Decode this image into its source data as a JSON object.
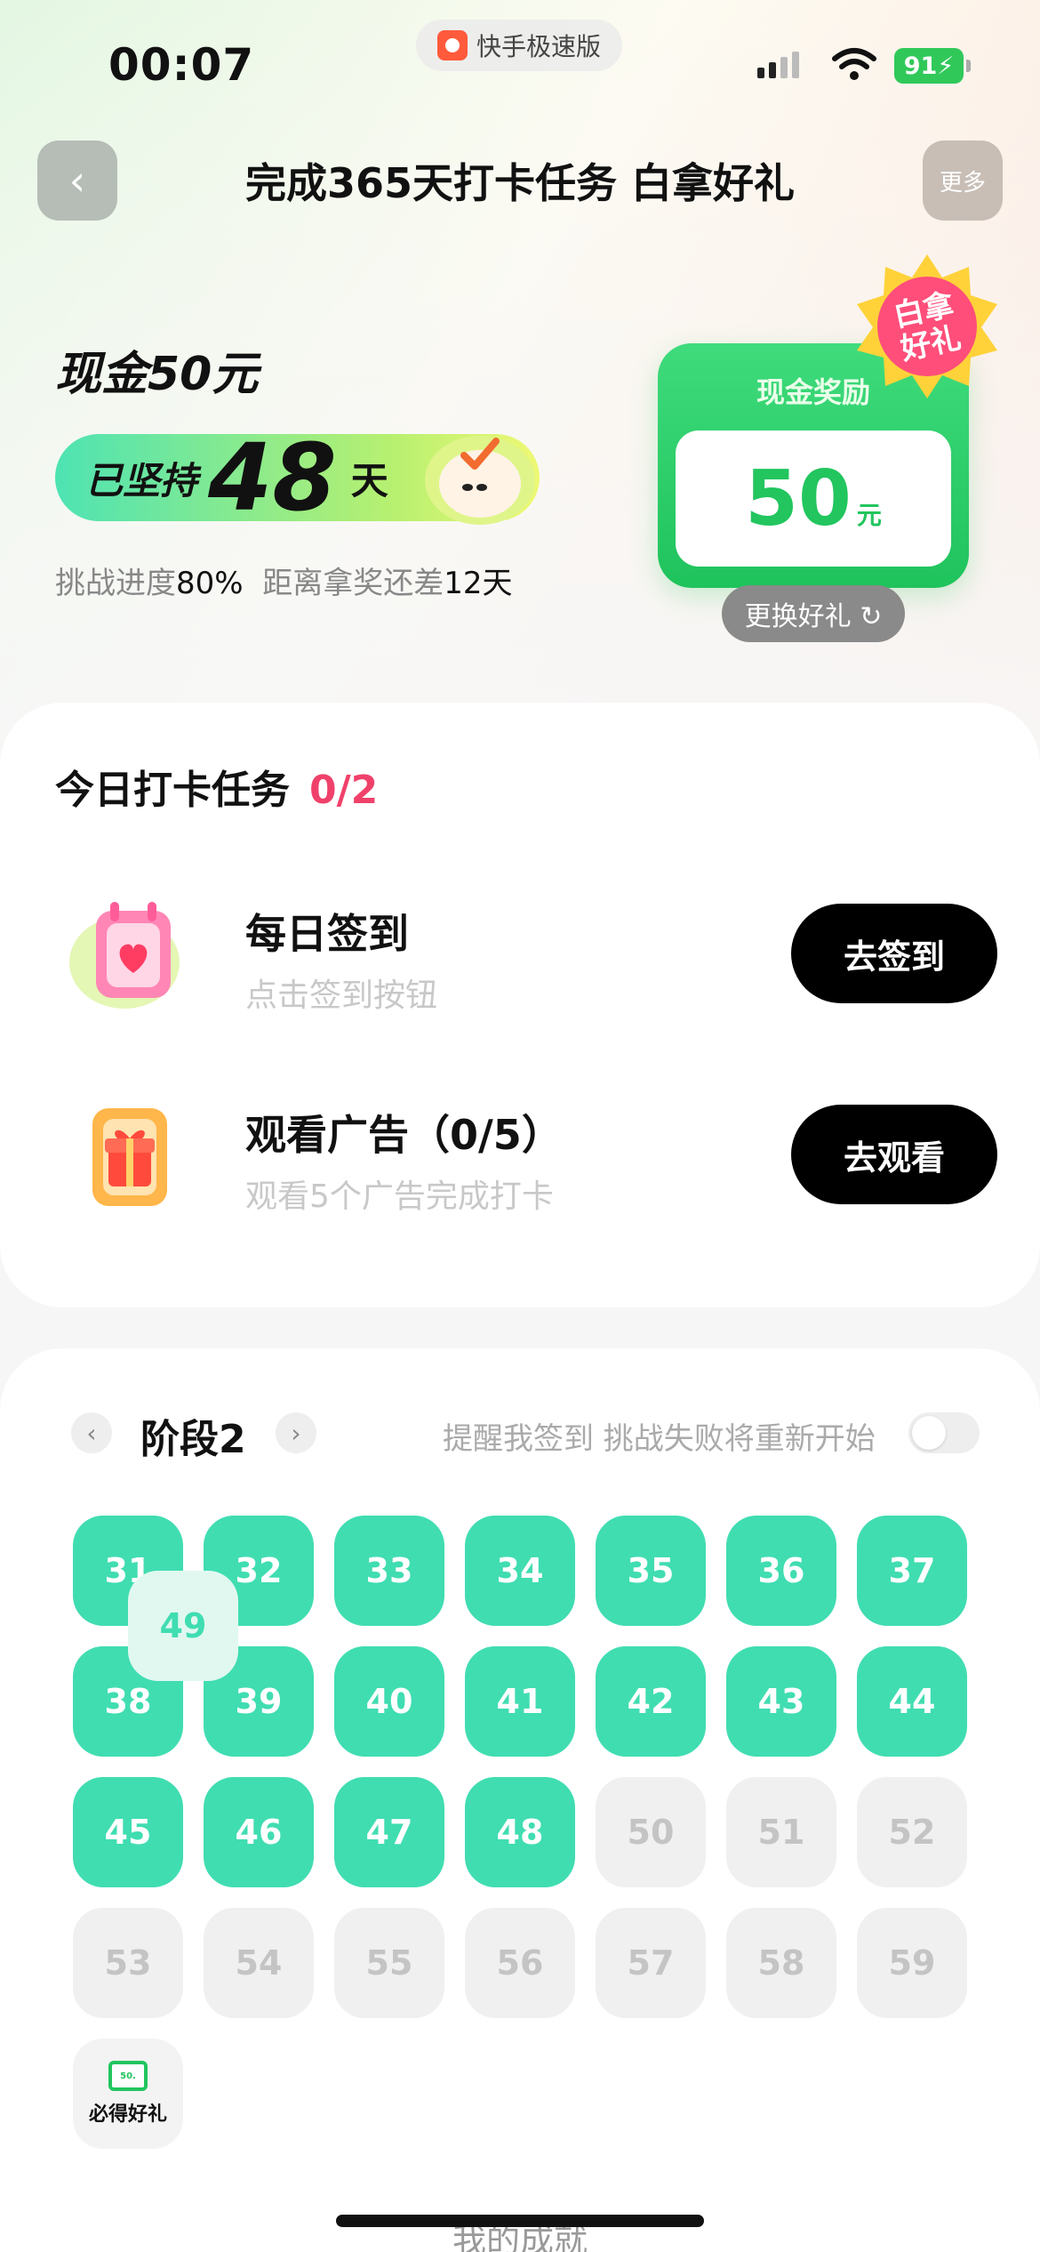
{
  "status_bar": {
    "time": "00:07",
    "app_name": "快手极速版",
    "battery": "91"
  },
  "nav": {
    "back_glyph": "‹",
    "title": "完成365天打卡任务 白拿好礼",
    "more": "更多"
  },
  "challenge": {
    "cash_title": "现金50元",
    "streak_prefix": "已坚持",
    "streak_days": "48",
    "streak_suffix": "天",
    "progress_label": "挑战进度",
    "progress_value": "80%",
    "remain_label": "距离拿奖还差",
    "remain_days": "12天"
  },
  "reward": {
    "label": "现金奖励",
    "amount": "50",
    "unit": "元",
    "badge": "白拿\n好礼",
    "swap": "更换好礼 ↻"
  },
  "today_tasks": {
    "title": "今日打卡任务",
    "count": "0/2",
    "items": [
      {
        "title": "每日签到",
        "subtitle": "点击签到按钮",
        "button": "去签到",
        "icon": "calendar-heart-icon"
      },
      {
        "title": "观看广告（0/5）",
        "subtitle": "观看5个广告完成打卡",
        "button": "去观看",
        "icon": "gift-box-icon"
      }
    ]
  },
  "stage": {
    "prev": "‹",
    "next": "›",
    "title": "阶段2",
    "remind": "提醒我签到 挑战失败将重新开始",
    "days": [
      {
        "n": "31",
        "s": "done"
      },
      {
        "n": "32",
        "s": "done"
      },
      {
        "n": "33",
        "s": "done"
      },
      {
        "n": "34",
        "s": "done"
      },
      {
        "n": "35",
        "s": "done"
      },
      {
        "n": "36",
        "s": "done"
      },
      {
        "n": "37",
        "s": "done"
      },
      {
        "n": "38",
        "s": "done"
      },
      {
        "n": "39",
        "s": "done"
      },
      {
        "n": "40",
        "s": "done"
      },
      {
        "n": "41",
        "s": "done"
      },
      {
        "n": "42",
        "s": "done"
      },
      {
        "n": "43",
        "s": "done"
      },
      {
        "n": "44",
        "s": "done"
      },
      {
        "n": "45",
        "s": "done"
      },
      {
        "n": "46",
        "s": "done"
      },
      {
        "n": "47",
        "s": "done"
      },
      {
        "n": "48",
        "s": "done"
      },
      {
        "n": "49",
        "s": "today"
      },
      {
        "n": "50",
        "s": "todo"
      },
      {
        "n": "51",
        "s": "todo"
      },
      {
        "n": "52",
        "s": "todo"
      },
      {
        "n": "53",
        "s": "todo"
      },
      {
        "n": "54",
        "s": "todo"
      },
      {
        "n": "55",
        "s": "todo"
      },
      {
        "n": "56",
        "s": "todo"
      },
      {
        "n": "57",
        "s": "todo"
      },
      {
        "n": "58",
        "s": "todo"
      },
      {
        "n": "59",
        "s": "todo"
      }
    ],
    "gift_label": "必得好礼",
    "gift_amount": "50."
  },
  "footer": {
    "section_title": "我的成就"
  },
  "colors": {
    "accent_green": "#40ddb1",
    "reward_green": "#22c55e",
    "count_pink": "#f0416b"
  }
}
